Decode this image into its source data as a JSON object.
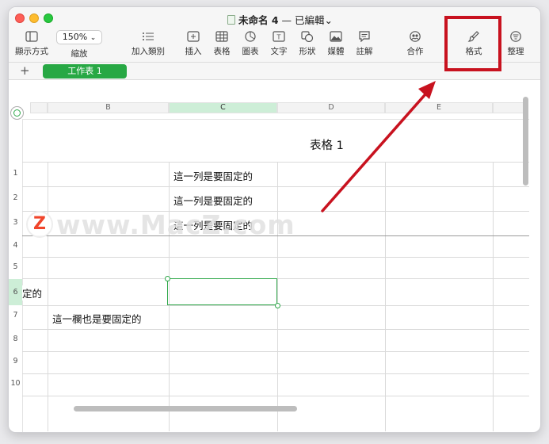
{
  "window": {
    "title_name": "未命名 4",
    "title_sep": "—",
    "title_status": "已編輯",
    "title_chevron": "⌄"
  },
  "toolbar": {
    "view_label": "顯示方式",
    "zoom_value": "150%",
    "zoom_label": "縮放",
    "add_category_label": "加入類別",
    "insert_label": "插入",
    "table_label": "表格",
    "chart_label": "圖表",
    "text_label": "文字",
    "shape_label": "形狀",
    "media_label": "媒體",
    "comment_label": "註解",
    "collaborate_label": "合作",
    "format_label": "格式",
    "organize_label": "整理"
  },
  "tabs": {
    "add_symbol": "+",
    "sheet1": "工作表 1"
  },
  "sheet": {
    "columns": [
      "B",
      "C",
      "D",
      "E"
    ],
    "rows": [
      "1",
      "2",
      "3",
      "4",
      "5",
      "6",
      "7",
      "8",
      "9",
      "10"
    ],
    "table_title": "表格 1",
    "row1_c": "這一列是要固定的",
    "row2_c": "這一列是要固定的",
    "row3_c": "這一列是要固定的",
    "row6_frozen": "定的",
    "row7_b": "這一欄也是要固定的"
  },
  "watermark": {
    "logo": "Z",
    "text": "www.MacZ.com"
  },
  "colors": {
    "accent_green": "#27a844",
    "annotation_red": "#c8121f"
  }
}
